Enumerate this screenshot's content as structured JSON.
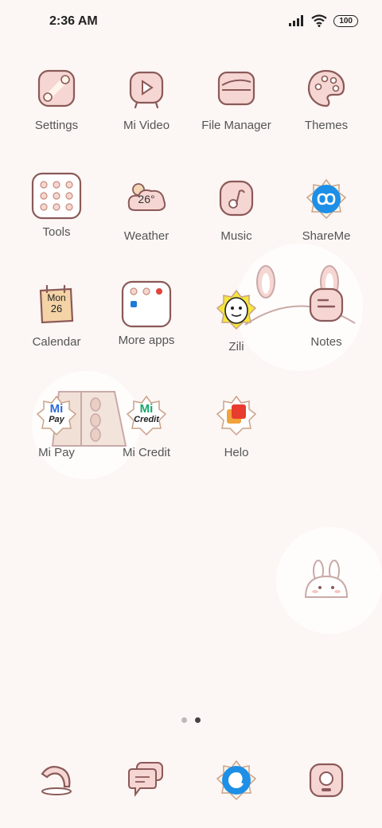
{
  "status_bar": {
    "time": "2:36 AM",
    "battery": "100"
  },
  "apps": [
    {
      "label": "Settings",
      "icon": "settings-icon"
    },
    {
      "label": "Mi Video",
      "icon": "video-icon"
    },
    {
      "label": "File Manager",
      "icon": "folder-icon"
    },
    {
      "label": "Themes",
      "icon": "palette-icon"
    },
    {
      "label": "Tools",
      "icon": "tools-folder-icon"
    },
    {
      "label": "Weather",
      "icon": "weather-icon",
      "temperature": "26°"
    },
    {
      "label": "Music",
      "icon": "music-icon"
    },
    {
      "label": "ShareMe",
      "icon": "shareme-icon"
    },
    {
      "label": "Calendar",
      "icon": "calendar-icon",
      "day": "Mon",
      "date": "26"
    },
    {
      "label": "More apps",
      "icon": "more-apps-folder-icon"
    },
    {
      "label": "Zili",
      "icon": "zili-icon"
    },
    {
      "label": "Notes",
      "icon": "notes-icon"
    },
    {
      "label": "Mi Pay",
      "icon": "mi-pay-icon",
      "badge_top": "Mi",
      "badge_bottom": "Pay"
    },
    {
      "label": "Mi Credit",
      "icon": "mi-credit-icon",
      "badge_top": "Mi",
      "badge_bottom": "Credit"
    },
    {
      "label": "Helo",
      "icon": "helo-icon"
    }
  ],
  "page_indicator": {
    "count": 2,
    "active": 2
  },
  "dock": [
    {
      "icon": "phone-icon"
    },
    {
      "icon": "messages-icon"
    },
    {
      "icon": "browser-icon"
    },
    {
      "icon": "camera-icon"
    }
  ],
  "colors": {
    "background": "#fcf6f4",
    "icon_fill": "#f6d6d3",
    "icon_stroke": "#8a5a58",
    "shareme_blue": "#1e8fe6"
  }
}
